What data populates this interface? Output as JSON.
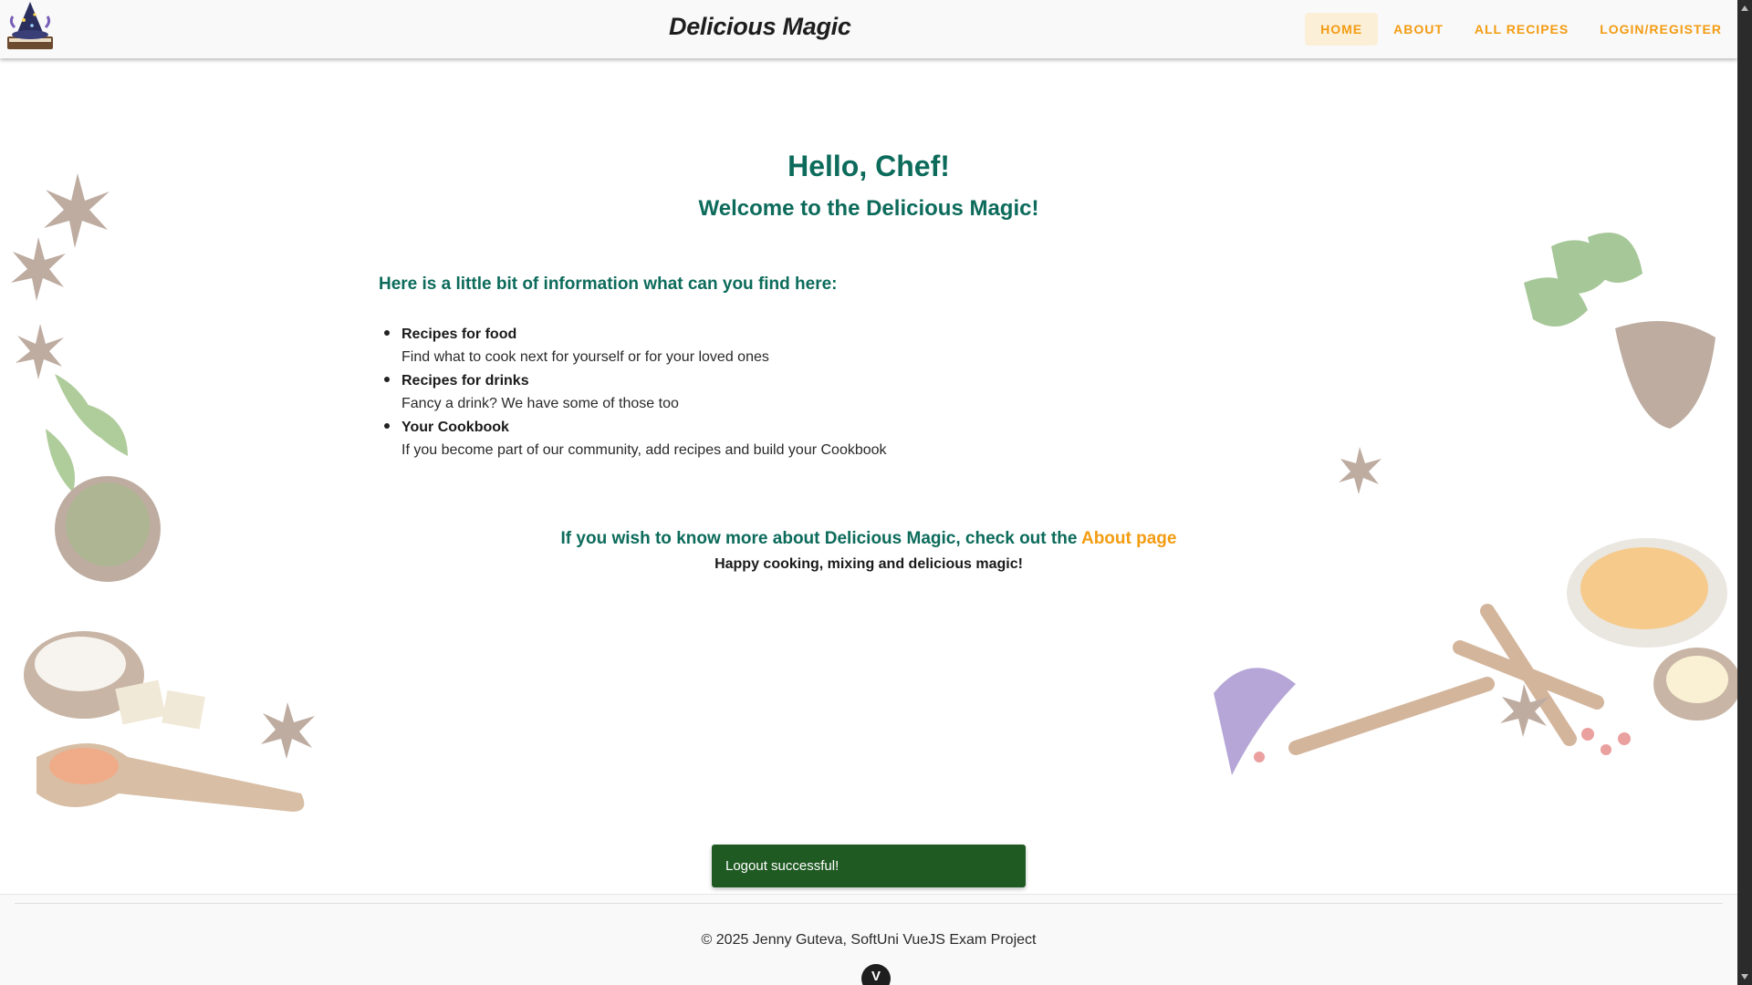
{
  "header": {
    "title": "Delicious Magic",
    "nav": [
      {
        "label": "HOME",
        "active": true
      },
      {
        "label": "ABOUT",
        "active": false
      },
      {
        "label": "ALL RECIPES",
        "active": false
      },
      {
        "label": "LOGIN/REGISTER",
        "active": false
      }
    ]
  },
  "main": {
    "greeting": "Hello, Chef!",
    "welcome": "Welcome to the Delicious Magic!",
    "info_heading": "Here is a little bit of information what can you find here:",
    "features": [
      {
        "title": "Recipes for food",
        "description": "Find what to cook next for yourself or for your loved ones"
      },
      {
        "title": "Recipes for drinks",
        "description": "Fancy a drink? We have some of those too"
      },
      {
        "title": "Your Cookbook",
        "description": "If you become part of our community, add recipes and build your Cookbook"
      }
    ],
    "about_prefix": "If you wish to know more about Delicious Magic, check out the ",
    "about_link": "About page",
    "closing": "Happy cooking, mixing and delicious magic!"
  },
  "toast": {
    "message": "Logout successful!"
  },
  "footer": {
    "text": "© 2025 Jenny Guteva, SoftUni VueJS Exam Project",
    "badge": "V"
  },
  "colors": {
    "primary_green": "#0c6b5b",
    "accent_orange": "#f39c12",
    "toast_green": "#1f5a23",
    "nav_active_bg": "#fcefd8"
  },
  "icons": {
    "logo": "wizard-hat-book-logo",
    "decor": "spices-and-herbs-illustration"
  }
}
